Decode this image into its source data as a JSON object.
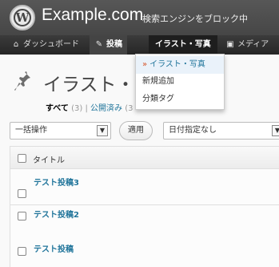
{
  "header": {
    "site_title": "Example.com",
    "tagline": "検索エンジンをブロック中"
  },
  "adminbar": {
    "dashboard_label": "ダッシュボード",
    "posts_label": "投稿",
    "illust_label": "イラスト・写真",
    "media_label": "メディア"
  },
  "dropdown": {
    "items": [
      {
        "label": "イラスト・写真",
        "active": true
      },
      {
        "label": "新規追加"
      },
      {
        "label": "分類タグ"
      }
    ]
  },
  "page": {
    "title": "イラスト・写真"
  },
  "filters": {
    "all_label": "すべて",
    "all_count": "(3)",
    "separator": "|",
    "published_label": "公開済み",
    "published_count": "(3"
  },
  "controls": {
    "bulk_action": "一括操作",
    "apply": "適用",
    "date_filter": "日付指定なし"
  },
  "table": {
    "header_title": "タイトル",
    "rows": [
      {
        "title": "テスト投稿3"
      },
      {
        "title": "テスト投稿2"
      },
      {
        "title": "テスト投稿"
      }
    ]
  },
  "colors": {
    "header_bg": "#464646",
    "adminbar_bg": "#2f2f2f",
    "link": "#21759b",
    "accent": "#d54e21"
  }
}
